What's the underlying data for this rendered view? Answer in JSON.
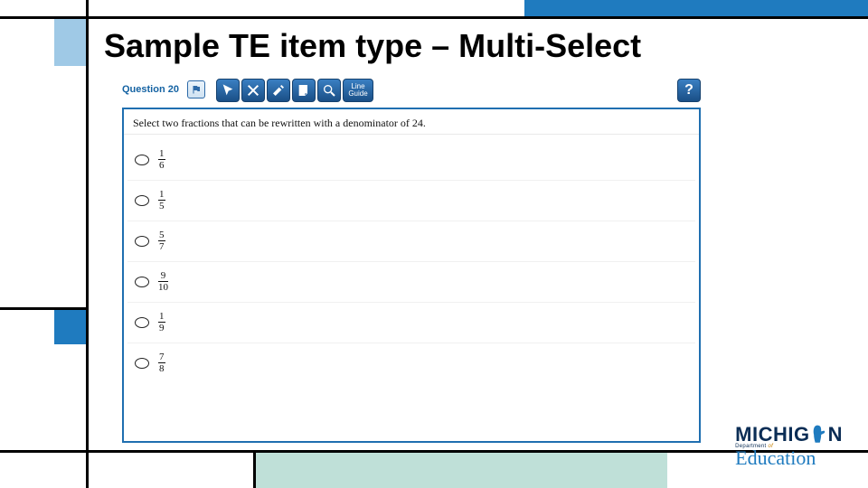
{
  "title": "Sample TE item type – Multi-Select",
  "quiz": {
    "question_label": "Question 20",
    "tools": {
      "pointer": "Pointer",
      "strike": "Strikethrough",
      "highlighter": "Highlighter",
      "note": "Note",
      "magnify": "Magnify",
      "line_guide": "Line Guide"
    },
    "help_label": "?",
    "prompt": "Select two fractions that can be rewritten with a denominator of 24.",
    "options": [
      {
        "num": "1",
        "den": "6"
      },
      {
        "num": "1",
        "den": "5"
      },
      {
        "num": "5",
        "den": "7"
      },
      {
        "num": "9",
        "den": "10"
      },
      {
        "num": "1",
        "den": "9"
      },
      {
        "num": "7",
        "den": "8"
      }
    ]
  },
  "logo": {
    "line1_a": "MICHIG",
    "line1_b": "N",
    "line2": "Department of",
    "line3": "Education"
  }
}
